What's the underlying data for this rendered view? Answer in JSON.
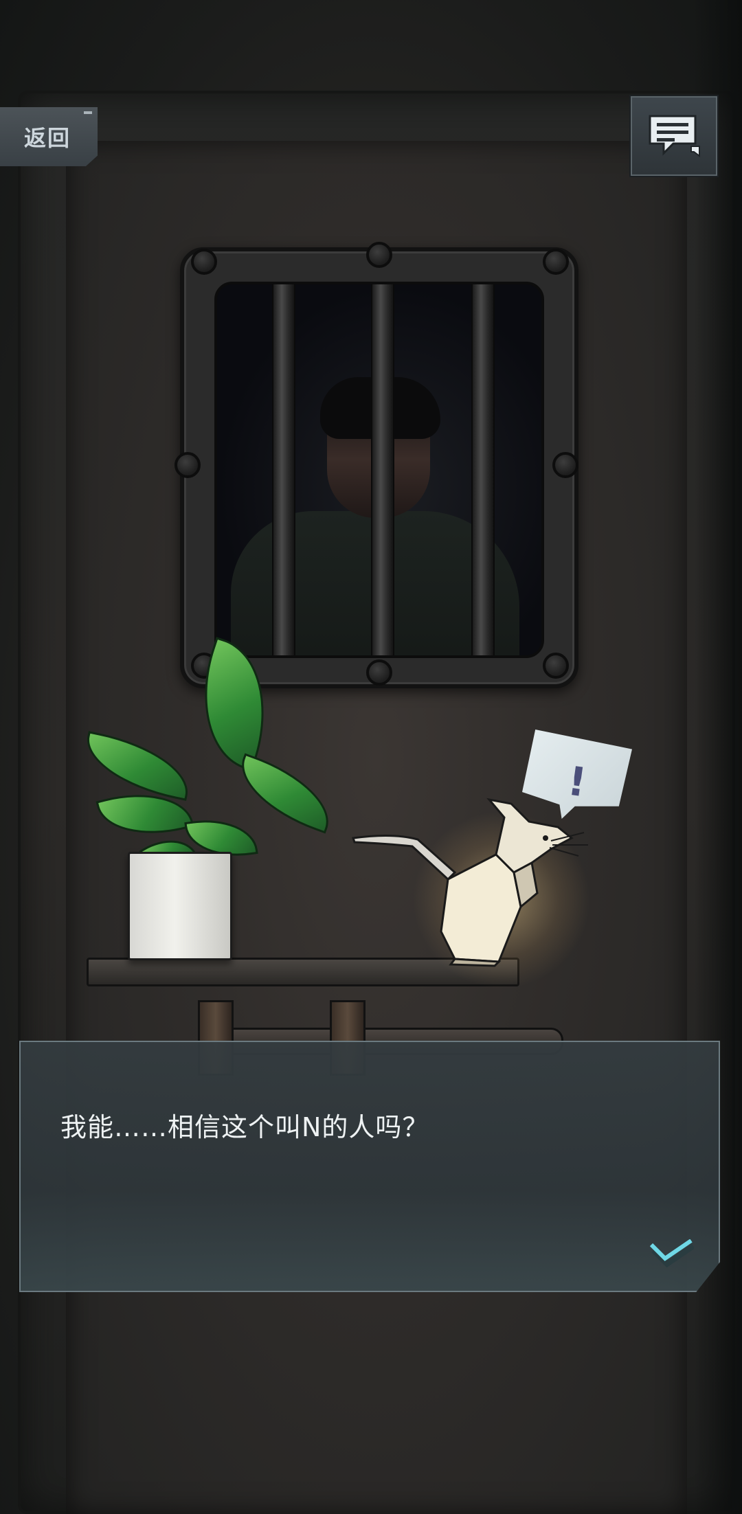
{
  "header": {
    "back_label": "返回",
    "back_icon": "back-arrow",
    "log_icon": "chat-log-icon"
  },
  "dialog": {
    "text": "我能……相信这个叫N的人吗？",
    "advance_icon": "chevron-down-icon"
  },
  "scene": {
    "bubble_mark": "!"
  },
  "colors": {
    "ui_panel": "#394045",
    "dialog_bg": "#343c40",
    "accent_cyan": "#6fd8e6",
    "leaf_green": "#2f8a35",
    "rat_glow": "#ffdc96"
  }
}
